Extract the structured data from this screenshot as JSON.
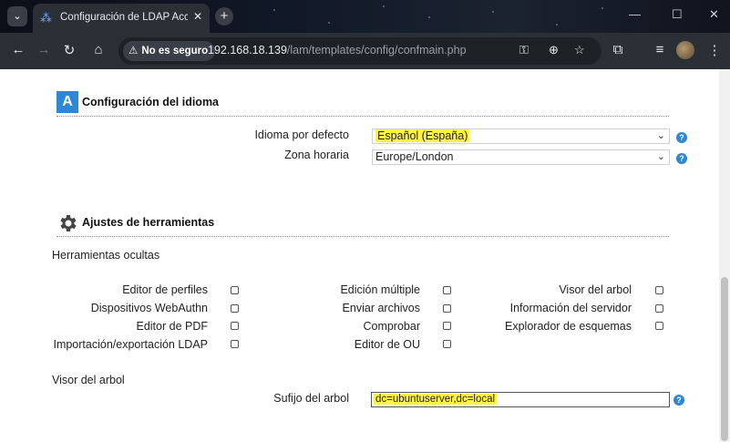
{
  "browser": {
    "tab_title": "Configuración de LDAP Account",
    "security_label": "No es seguro",
    "url_host": "192.168.18.139",
    "url_path": "/lam/templates/config/confmain.php"
  },
  "language_section": {
    "title": "Configuración del idioma",
    "default_language_label": "Idioma por defecto",
    "default_language_value": "Español (España)",
    "timezone_label": "Zona horaria",
    "timezone_value": "Europe/London"
  },
  "tools_section": {
    "title": "Ajustes de herramientas",
    "hidden_tools_label": "Herramientas ocultas",
    "tools": [
      {
        "label": "Editor de perfiles",
        "checked": false
      },
      {
        "label": "Dispositivos WebAuthn",
        "checked": false
      },
      {
        "label": "Editor de PDF",
        "checked": false
      },
      {
        "label": "Importación/exportación LDAP",
        "checked": false
      },
      {
        "label": "Edición múltiple",
        "checked": false
      },
      {
        "label": "Enviar archivos",
        "checked": false
      },
      {
        "label": "Comprobar",
        "checked": false
      },
      {
        "label": "Editor de OU",
        "checked": false
      },
      {
        "label": "Visor del arbol",
        "checked": false
      },
      {
        "label": "Información del servidor",
        "checked": false
      },
      {
        "label": "Explorador de esquemas",
        "checked": false
      }
    ],
    "tree_viewer_heading": "Visor del arbol",
    "tree_suffix_label": "Sufijo del arbol",
    "tree_suffix_value": "dc=ubuntuserver,dc=local"
  },
  "colors": {
    "highlight": "#fff347",
    "accent": "#2e86d6"
  }
}
